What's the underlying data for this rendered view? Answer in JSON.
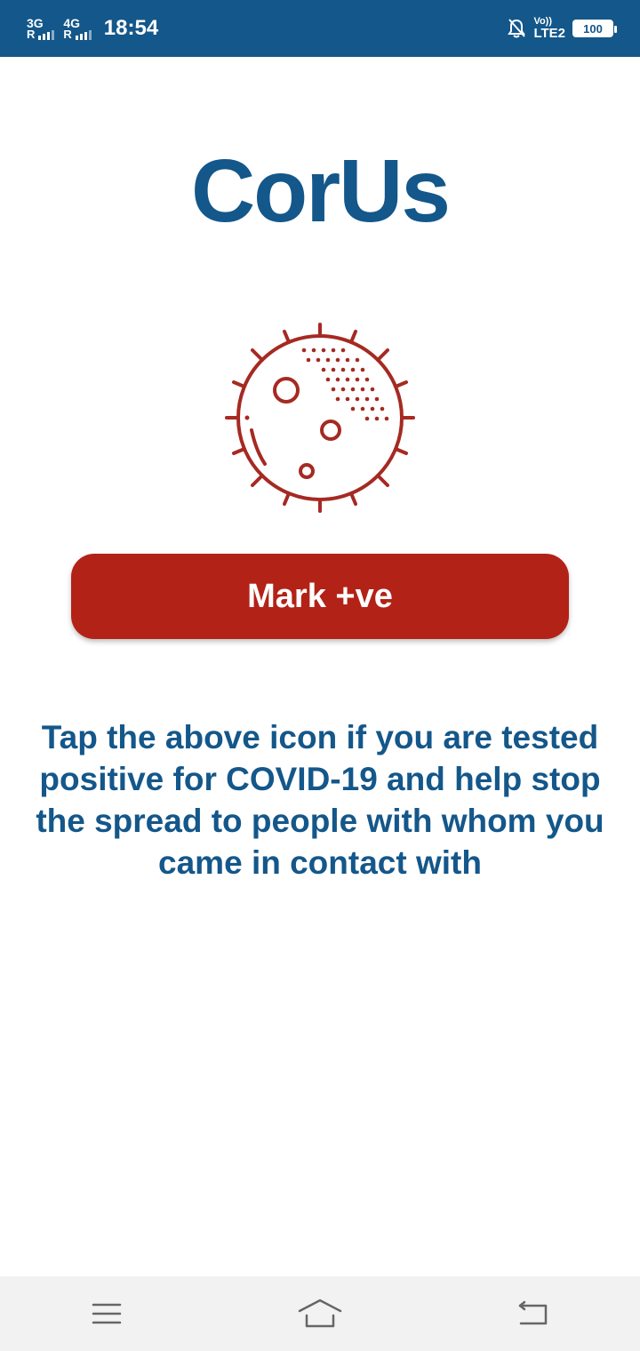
{
  "status_bar": {
    "sim1_network": "3G",
    "sim2_network": "4G",
    "roaming": "R",
    "time": "18:54",
    "volte_top": "Vo))",
    "volte_bottom": "LTE2",
    "battery": "100"
  },
  "app": {
    "title": "CorUs",
    "icon": "virus-icon",
    "button_label": "Mark +ve",
    "description": "Tap the above icon if you are tested positive for COVID-19 and help stop the spread to people with whom you came in contact with"
  },
  "nav": {
    "menu_icon": "menu-icon",
    "home_icon": "home-icon",
    "back_icon": "back-icon"
  },
  "colors": {
    "primary": "#14578a",
    "accent": "#b32217",
    "icon": "#a52a22"
  }
}
